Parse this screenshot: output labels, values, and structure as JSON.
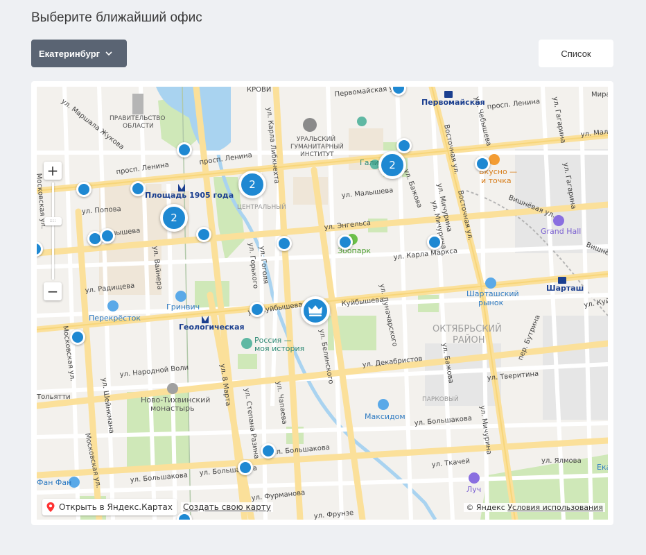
{
  "page": {
    "title": "Выберите ближайший офис"
  },
  "controls": {
    "city": "Екатеринбург",
    "list_button": "Список"
  },
  "map": {
    "open_in_yandex": "Открыть в Яндекс.Картах",
    "create_map": "Создать свою карту",
    "copyright": "© Яндекс",
    "terms": "Условия использования",
    "zoom_in": "+",
    "zoom_out": "−",
    "clusters": [
      "2",
      "2",
      "2"
    ],
    "streets": {
      "lenina": "просп. Ленина",
      "lenina2": "просп. Ленина",
      "lenina3": "просп. Ленина",
      "malysheva": "ул. Малышева",
      "malysheva2": "ул. Малышева",
      "malysheva3": "ул. Мал",
      "kuybysheva": "ул. Куйбышева",
      "kuybysheva2": "Куйбышева",
      "kuybysheva3": "ул. Куйб",
      "dekabristov": "ул. Декабристов",
      "tkachey": "ул. Ткачей",
      "furmanova": "ул. Фурманова",
      "bolshakova": "ул. Большакова",
      "bolshakova2": "ул. Большакова",
      "bolshakova3": "ул. Большакова",
      "bolshakova4": "ул. Большакова",
      "radishcheva": "ул. Радищева",
      "popova": "ул. Попова",
      "narodnoy_voli": "ул. Народной Воли",
      "engelsa": "ул. Энгельса",
      "karla_marksa": "ул. Карла Маркса",
      "pervomayskaya": "Первомайская ул.",
      "pervomayskaya2": "Первомайская",
      "vostochnaya": "Восточная ул.",
      "vostochnaya2": "Восточная ул.",
      "moskovskaya": "Московская ул.",
      "moskovskaya2": "Московская ул.",
      "moskovskaya3": "Московская ул.",
      "marshala_zhukova": "ул. Маршала Жукова",
      "8_marta": "ул. 8 Марта",
      "belinskogo": "ул. Белинского",
      "lunacharskogo": "ул. Луначарского",
      "karla_libknekhta": "ул. Карла Либкнехта",
      "gogolya": "ул. Гоголя",
      "gorkogo": "ул. Горького",
      "stepana_razina": "ул. Степана Разина",
      "chapaeva": "ул. Чапаева",
      "michurina": "ул. Мичурина",
      "michurina2": "ул. Мичурина",
      "michurina3": "ул. Мичурина",
      "gagarina": "ул. Гагарина",
      "gagarina2": "ул. Гагарина",
      "mira": "Мира",
      "bazhova": "ул. Бажова",
      "bazhova2": "ул. Бажова",
      "chebysheva": "ул. Чебышева",
      "vishnevaya": "Вишнёвая ул.",
      "vishnevaya2": "Вишнёвая ул.",
      "tverityna": "ул. Тверитина",
      "butorina": "пер. Бутрина",
      "yalamova": "ул. Ялмова",
      "shevchenko": "ул. Шейнкмана",
      "tolyatti": "Тольятти",
      "malyshev_mid": "ул. Малышева",
      "frunze": "ул. Фрунзе",
      "vaynera": "ул. Вайнера",
      "krovi": "КРОВИ"
    },
    "areas": {
      "oktyabrsky": "ОКТЯБРЬСКИЙ",
      "rayon": "РАЙОН",
      "centralny": "ЦЕНТРАЛЬНЫЙ",
      "parkovy": "ПАРКОВЫЙ"
    },
    "pois": {
      "government1": "ПРАВИТЕЛЬСТВО",
      "government2": "ОБЛАСТИ",
      "institute1": "УРАЛЬСКИЙ",
      "institute2": "ГУМАНИТАРНЫЙ",
      "institute3": "ИНСТИТУТ",
      "ploshchad": "Площадь 1905 года",
      "geologicheskaya": "Геологическая",
      "pervomayskaya_metro": "Первомайская",
      "galileo": "Галилео",
      "vkusno1": "Вкусно —",
      "vkusno2": "и точка",
      "grand_hall": "Grand Hall",
      "zoopark": "Зоопарк",
      "shartash_market1": "Шарташский",
      "shartash_market2": "рынок",
      "shartash": "Шарташ",
      "grinvich": "Гринвич",
      "perekrestok": "Перекрёсток",
      "russia1": "Россия —",
      "russia2": "моя история",
      "novo1": "Ново-Тихвинский",
      "novo2": "монастырь",
      "maksidom": "Максидом",
      "fanfan": "Фан Фан",
      "luch": "Луч",
      "eka": "Ека"
    }
  }
}
